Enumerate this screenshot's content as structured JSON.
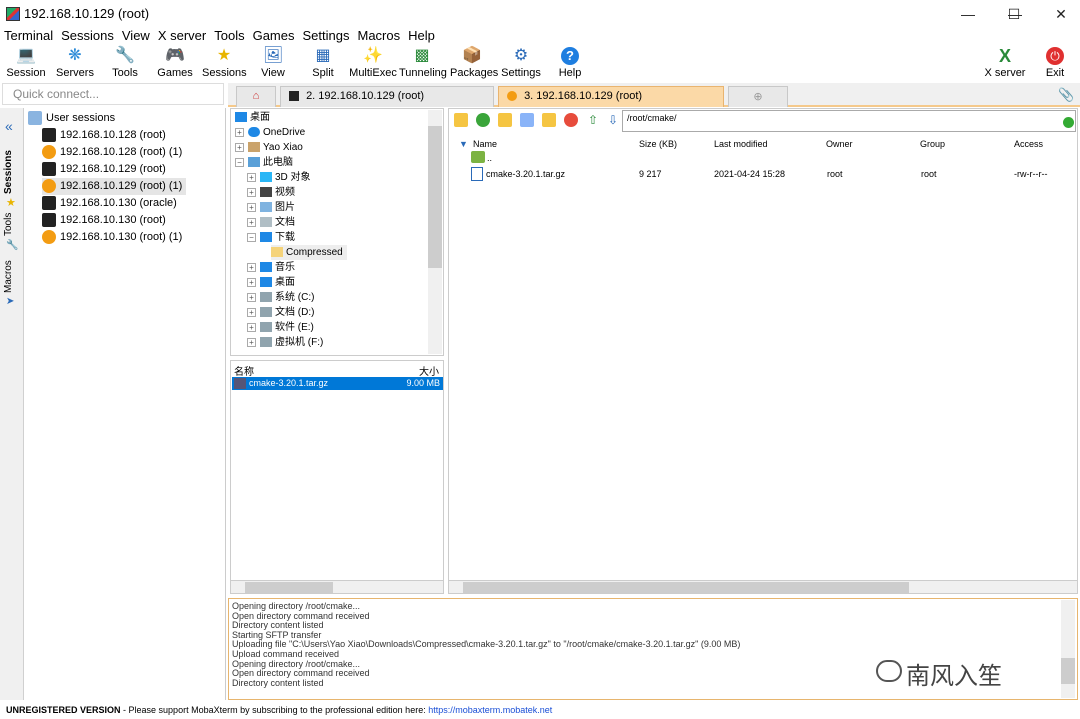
{
  "window": {
    "title": "192.168.10.129 (root)"
  },
  "menu": [
    "Terminal",
    "Sessions",
    "View",
    "X server",
    "Tools",
    "Games",
    "Settings",
    "Macros",
    "Help"
  ],
  "toolbar": {
    "buttons": [
      {
        "label": "Session",
        "icon": "monitor-session-icon"
      },
      {
        "label": "Servers",
        "icon": "servers-network-icon"
      },
      {
        "label": "Tools",
        "icon": "tools-icon"
      },
      {
        "label": "Games",
        "icon": "gamepad-icon"
      },
      {
        "label": "Sessions",
        "icon": "star-icon"
      },
      {
        "label": "View",
        "icon": "view-icon"
      },
      {
        "label": "Split",
        "icon": "split-icon"
      },
      {
        "label": "MultiExec",
        "icon": "multiexec-fork-icon"
      },
      {
        "label": "Tunneling",
        "icon": "tunneling-icon"
      },
      {
        "label": "Packages",
        "icon": "packages-icon"
      },
      {
        "label": "Settings",
        "icon": "gear-icon"
      },
      {
        "label": "Help",
        "icon": "question-icon"
      }
    ],
    "xserver_label": "X server",
    "exit_label": "Exit"
  },
  "quick_connect": {
    "placeholder": "Quick connect..."
  },
  "tabs": [
    {
      "label": "2. 192.168.10.129 (root)",
      "active": false
    },
    {
      "label": "3. 192.168.10.129 (root)",
      "active": true
    }
  ],
  "side_tabs": [
    "Sessions",
    "Tools",
    "Macros"
  ],
  "sessions": {
    "root_label": "User sessions",
    "items": [
      {
        "label": "192.168.10.128 (root)",
        "type": "ssh"
      },
      {
        "label": "192.168.10.128 (root) (1)",
        "type": "sftp"
      },
      {
        "label": "192.168.10.129 (root)",
        "type": "ssh"
      },
      {
        "label": "192.168.10.129 (root) (1)",
        "type": "sftp"
      },
      {
        "label": "192.168.10.130 (oracle)",
        "type": "ssh"
      },
      {
        "label": "192.168.10.130 (root)",
        "type": "ssh"
      },
      {
        "label": "192.168.10.130 (root) (1)",
        "type": "sftp"
      }
    ]
  },
  "local_tree": {
    "items": [
      {
        "label": "桌面"
      },
      {
        "label": "OneDrive"
      },
      {
        "label": "Yao Xiao"
      },
      {
        "label": "此电脑"
      },
      {
        "label": "3D 对象"
      },
      {
        "label": "视频"
      },
      {
        "label": "图片"
      },
      {
        "label": "文档"
      },
      {
        "label": "下载"
      },
      {
        "label": "Compressed"
      },
      {
        "label": "音乐"
      },
      {
        "label": "桌面"
      },
      {
        "label": "系统 (C:)"
      },
      {
        "label": "文档 (D:)"
      },
      {
        "label": "软件 (E:)"
      },
      {
        "label": "虚拟机 (F:)"
      }
    ]
  },
  "local_files": {
    "headers": {
      "name": "名称",
      "size": "大小"
    },
    "rows": [
      {
        "name": "cmake-3.20.1.tar.gz",
        "size": "9.00 MB"
      }
    ]
  },
  "remote": {
    "path": "/root/cmake/",
    "headers": [
      "Name",
      "Size (KB)",
      "Last modified",
      "Owner",
      "Group",
      "Access"
    ],
    "parent_label": "..",
    "rows": [
      {
        "name": "cmake-3.20.1.tar.gz",
        "size": "9 217",
        "modified": "2021-04-24 15:28",
        "owner": "root",
        "group": "root",
        "access": "-rw-r--r--"
      }
    ]
  },
  "log": [
    "Opening directory /root/cmake...",
    "Open directory command received",
    "Directory content listed",
    "Starting SFTP transfer",
    "Uploading file \"C:\\Users\\Yao Xiao\\Downloads\\Compressed\\cmake-3.20.1.tar.gz\" to \"/root/cmake/cmake-3.20.1.tar.gz\" (9.00 MB)",
    "Upload command received",
    "Opening directory /root/cmake...",
    "Open directory command received",
    "Directory content listed"
  ],
  "watermark": "南风入笙",
  "status": {
    "unregistered": "UNREGISTERED VERSION",
    "separator": " - ",
    "message": "Please support MobaXterm by subscribing to the professional edition here:",
    "link": "https://mobaxterm.mobatek.net"
  },
  "colors": {
    "accent_tab": "#fbd9a7",
    "selection": "#0078d7",
    "link": "#1a4fd6"
  }
}
